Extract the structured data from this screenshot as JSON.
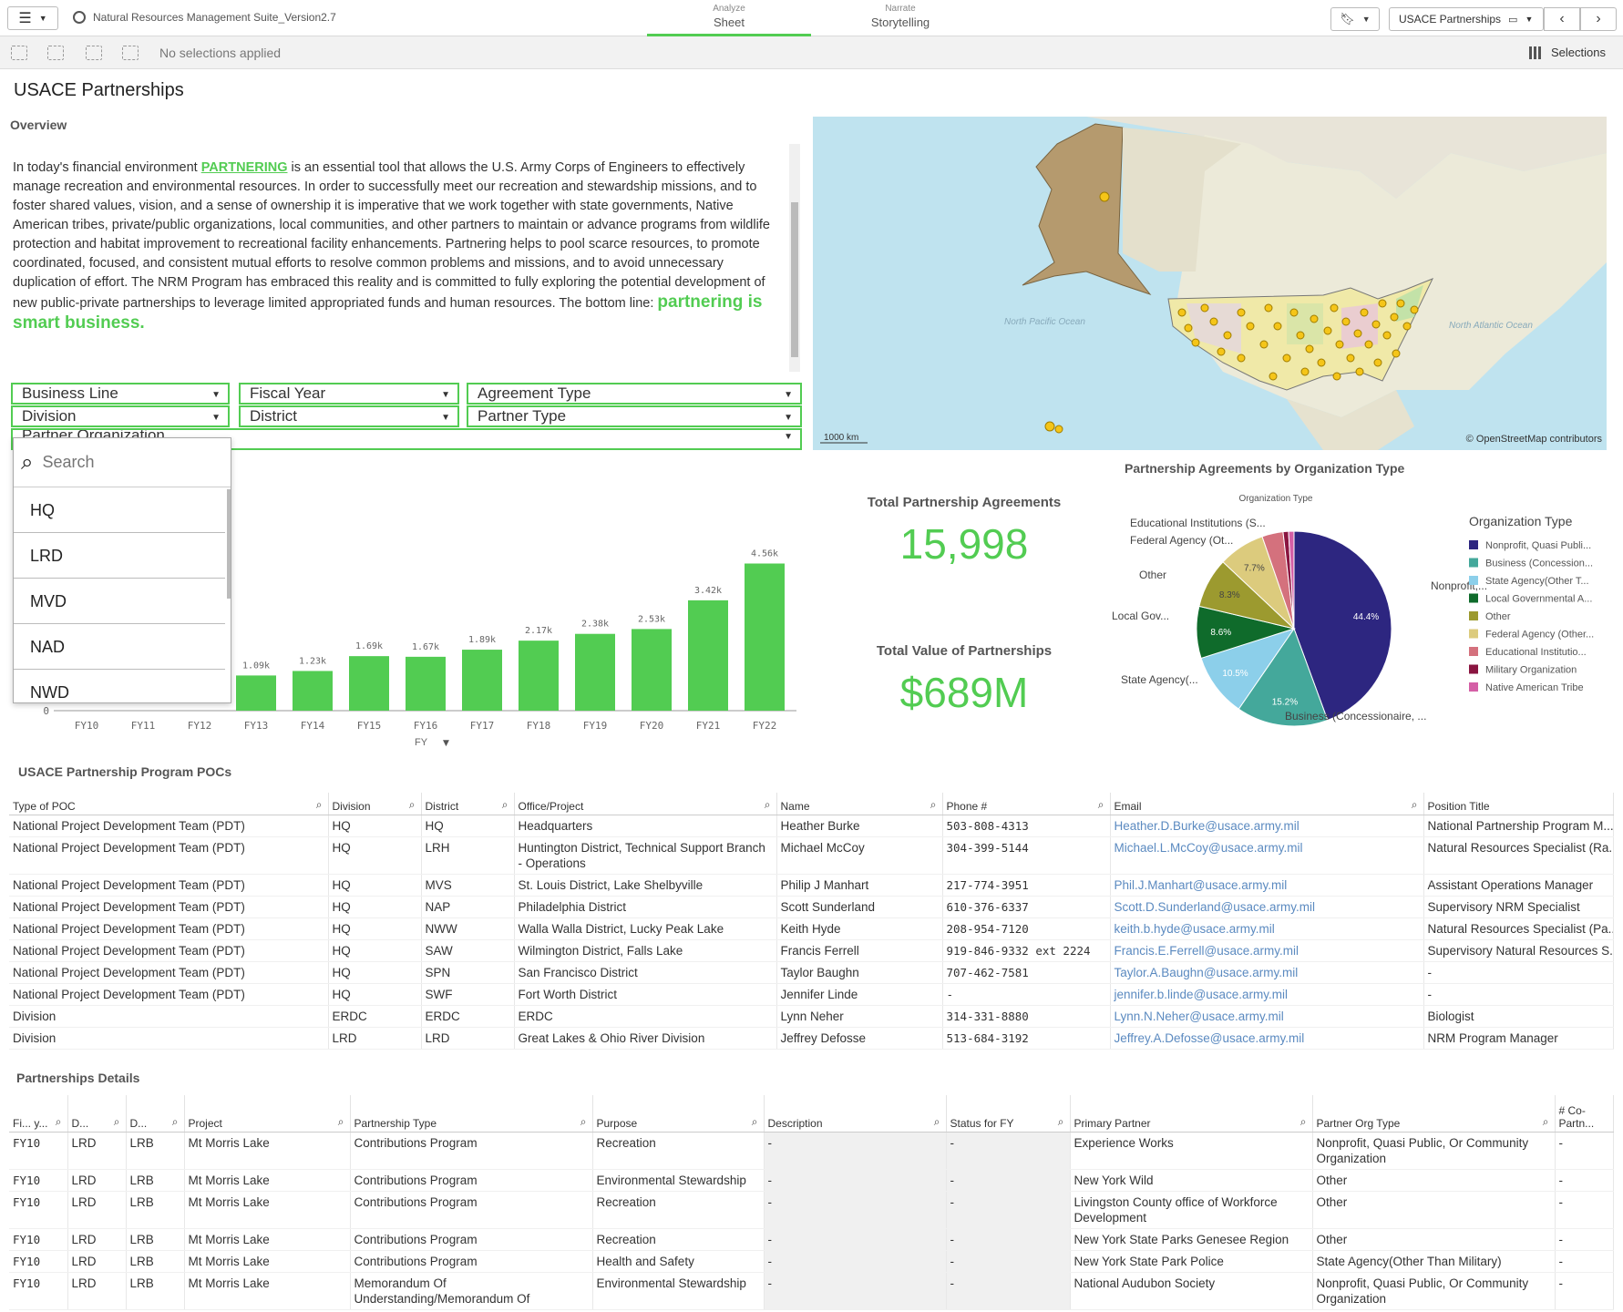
{
  "topbar": {
    "app_title": "Natural Resources Management Suite_Version2.7",
    "tabs": [
      {
        "small": "Analyze",
        "big": "Sheet"
      },
      {
        "small": "Narrate",
        "big": "Storytelling"
      }
    ],
    "sheet_name": "USACE Partnerships"
  },
  "selection_bar": {
    "status": "No selections applied",
    "selections_label": "Selections"
  },
  "sheet_title": "USACE Partnerships",
  "overview": {
    "title": "Overview",
    "text_before": "In today's financial environment ",
    "highlight": "PARTNERING",
    "text_after": " is an essential tool that allows the U.S. Army Corps of Engineers to effectively manage recreation and environmental resources. In order to successfully meet our recreation and stewardship missions, and to foster shared values, vision, and a sense of ownership it is imperative that we work together with state governments, Native American tribes, private/public organizations, local communities, and other partners to maintain or advance programs from wildlife protection and habitat improvement to recreational facility enhancements. Partnering helps to pool scarce resources, to promote coordinated, focused, and consistent mutual efforts to resolve common problems and missions, and to avoid unnecessary duplication of effort. The NRM Program has embraced this reality and is committed to fully exploring the potential development of new public-private partnerships to leverage limited appropriated funds and human resources. The bottom line: ",
    "tagline": "partnering is smart business."
  },
  "filters": [
    "Business Line",
    "Fiscal Year",
    "Agreement Type",
    "Division",
    "District",
    "Partner Type",
    "Partner Organization"
  ],
  "dropdown": {
    "placeholder": "Search",
    "items": [
      "HQ",
      "LRD",
      "MVD",
      "NAD",
      "NWD"
    ]
  },
  "map": {
    "attribution": "© OpenStreetMap contributors",
    "scale": "1000 km",
    "ocean_left": "North Pacific Ocean",
    "ocean_right": "North Atlantic Ocean"
  },
  "kpis": {
    "agreements_label": "Total Partnership Agreements",
    "agreements_value": "15,998",
    "value_label": "Total Value of Partnerships",
    "value_value": "$689M"
  },
  "bar_chart": {
    "x_label": "FY",
    "zero_label": "0"
  },
  "chart_data": [
    {
      "type": "bar",
      "categories": [
        "FY10",
        "FY11",
        "FY12",
        "FY13",
        "FY14",
        "FY15",
        "FY16",
        "FY17",
        "FY18",
        "FY19",
        "FY20",
        "FY21",
        "FY22"
      ],
      "values": [
        null,
        null,
        null,
        1090,
        1230,
        1690,
        1670,
        1890,
        2170,
        2380,
        2530,
        3420,
        4560
      ],
      "value_labels": [
        "",
        "",
        "",
        "1.09k",
        "1.23k",
        "1.69k",
        "1.67k",
        "1.89k",
        "2.17k",
        "2.38k",
        "2.53k",
        "3.42k",
        "4.56k"
      ],
      "xlabel": "FY",
      "ylim": [
        0,
        4800
      ],
      "color": "#52cc52"
    },
    {
      "type": "pie",
      "title": "Partnership Agreements by Organization Type",
      "dimension_label": "Organization Type",
      "legend_title": "Organization Type",
      "slices": [
        {
          "name": "Nonprofit, Quasi Publi...",
          "value": 44.4,
          "color": "#2d2680",
          "label": "Nonprofit,..."
        },
        {
          "name": "Business (Concession...",
          "value": 15.2,
          "color": "#44a89b",
          "label": "Business (Concessionaire, ..."
        },
        {
          "name": "State Agency(Other T...",
          "value": 10.5,
          "color": "#8ccfea",
          "label": "State Agency(..."
        },
        {
          "name": "Local Governmental A...",
          "value": 8.6,
          "color": "#0f6b2b",
          "label": "Local Gov..."
        },
        {
          "name": "Other",
          "value": 8.3,
          "color": "#9c9a2f",
          "label": "Other"
        },
        {
          "name": "Federal Agency (Other...",
          "value": 7.7,
          "color": "#dccb7d",
          "label": "Federal Agency (Ot..."
        },
        {
          "name": "Educational Institutio...",
          "value": 3.5,
          "color": "#d4717d",
          "label": "Educational Institutions (S..."
        },
        {
          "name": "Military Organization",
          "value": 0.9,
          "color": "#8a1540",
          "label": ""
        },
        {
          "name": "Native American Tribe",
          "value": 0.9,
          "color": "#d45fa6",
          "label": ""
        }
      ]
    }
  ],
  "poc_table": {
    "title": "USACE Partnership Program POCs",
    "columns": [
      "Type of POC",
      "Division",
      "District",
      "Office/Project",
      "Name",
      "Phone #",
      "Email",
      "Position Title"
    ],
    "rows": [
      [
        "National Project Development Team (PDT)",
        "HQ",
        "HQ",
        "Headquarters",
        "Heather Burke",
        "503-808-4313",
        "Heather.D.Burke@usace.army.mil",
        "National Partnership Program M..."
      ],
      [
        "National Project Development Team (PDT)",
        "HQ",
        "LRH",
        "Huntington District, Technical Support Branch - Operations",
        "Michael McCoy",
        "304-399-5144",
        "Michael.L.McCoy@usace.army.mil",
        "Natural Resources Specialist (Ra..."
      ],
      [
        "National Project Development Team (PDT)",
        "HQ",
        "MVS",
        "St. Louis District, Lake Shelbyville",
        "Philip J Manhart",
        "217-774-3951",
        "Phil.J.Manhart@usace.army.mil",
        "Assistant Operations Manager"
      ],
      [
        "National Project Development Team (PDT)",
        "HQ",
        "NAP",
        "Philadelphia District",
        "Scott Sunderland",
        "610-376-6337",
        "Scott.D.Sunderland@usace.army.mil",
        "Supervisory NRM Specialist"
      ],
      [
        "National Project Development Team (PDT)",
        "HQ",
        "NWW",
        "Walla Walla District, Lucky Peak Lake",
        "Keith Hyde",
        "208-954-7120",
        "keith.b.hyde@usace.army.mil",
        "Natural Resources Specialist (Pa..."
      ],
      [
        "National Project Development Team (PDT)",
        "HQ",
        "SAW",
        "Wilmington District, Falls Lake",
        "Francis Ferrell",
        "919-846-9332 ext 2224",
        "Francis.E.Ferrell@usace.army.mil",
        "Supervisory Natural Resources S..."
      ],
      [
        "National Project Development Team (PDT)",
        "HQ",
        "SPN",
        "San Francisco District",
        "Taylor Baughn",
        "707-462-7581",
        "Taylor.A.Baughn@usace.army.mil",
        "-"
      ],
      [
        "National Project Development Team (PDT)",
        "HQ",
        "SWF",
        "Fort Worth District",
        "Jennifer Linde",
        "-",
        "jennifer.b.linde@usace.army.mil",
        "-"
      ],
      [
        "Division",
        "ERDC",
        "ERDC",
        "ERDC",
        "Lynn Neher",
        "314-331-8880",
        "Lynn.N.Neher@usace.army.mil",
        "Biologist"
      ],
      [
        "Division",
        "LRD",
        "LRD",
        "Great Lakes & Ohio River Division",
        "Jeffrey Defosse",
        "513-684-3192",
        "Jeffrey.A.Defosse@usace.army.mil",
        "NRM Program Manager"
      ]
    ]
  },
  "details_table": {
    "title": "Partnerships Details",
    "columns": [
      "Fi... y...",
      "D...",
      "D...",
      "Project",
      "Partnership Type",
      "Purpose",
      "Description",
      "Status for FY",
      "Primary Partner",
      "Partner Org Type",
      "# Co-Partn..."
    ],
    "rows": [
      [
        "FY10",
        "LRD",
        "LRB",
        "Mt Morris Lake",
        "Contributions Program",
        "Recreation",
        "-",
        "-",
        "Experience Works",
        "Nonprofit, Quasi Public, Or Community Organization",
        "-"
      ],
      [
        "FY10",
        "LRD",
        "LRB",
        "Mt Morris Lake",
        "Contributions Program",
        "Environmental Stewardship",
        "-",
        "-",
        "New York Wild",
        "Other",
        "-"
      ],
      [
        "FY10",
        "LRD",
        "LRB",
        "Mt Morris Lake",
        "Contributions Program",
        "Recreation",
        "-",
        "-",
        "Livingston County office of Workforce Development",
        "Other",
        "-"
      ],
      [
        "FY10",
        "LRD",
        "LRB",
        "Mt Morris Lake",
        "Contributions Program",
        "Recreation",
        "-",
        "-",
        "New York State Parks Genesee Region",
        "Other",
        "-"
      ],
      [
        "FY10",
        "LRD",
        "LRB",
        "Mt Morris Lake",
        "Contributions Program",
        "Health and Safety",
        "-",
        "-",
        "New York State Park Police",
        "State Agency(Other Than Military)",
        "-"
      ],
      [
        "FY10",
        "LRD",
        "LRB",
        "Mt Morris Lake",
        "Memorandum Of Understanding/Memorandum Of",
        "Environmental Stewardship",
        "-",
        "-",
        "National Audubon Society",
        "Nonprofit, Quasi Public, Or Community Organization",
        "-"
      ]
    ]
  }
}
